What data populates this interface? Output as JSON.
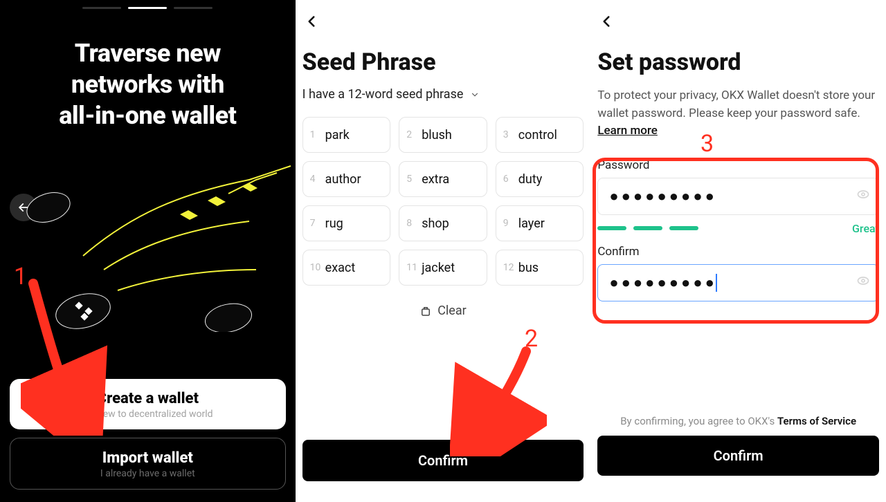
{
  "annotations": {
    "n1": "1",
    "n2": "2",
    "n3": "3"
  },
  "panel1": {
    "headline_l1": "Traverse new",
    "headline_l2": "networks with",
    "headline_l3": "all-in-one wallet",
    "create_title": "Create a wallet",
    "create_sub": "I'm new to decentralized world",
    "import_title": "Import wallet",
    "import_sub": "I already have a wallet"
  },
  "panel2": {
    "title": "Seed Phrase",
    "select_label": "I have a 12-word seed phrase",
    "words": [
      "park",
      "blush",
      "control",
      "author",
      "extra",
      "duty",
      "rug",
      "shop",
      "layer",
      "exact",
      "jacket",
      "bus"
    ],
    "clear": "Clear",
    "confirm": "Confirm"
  },
  "panel3": {
    "title": "Set password",
    "desc_a": "To protect your privacy, OKX Wallet doesn't store your wallet password. Please keep your password safe.  ",
    "learn": "Learn more",
    "pwd_label": "Password",
    "pwd_mask": "●●●●●●●●●",
    "confirm_label": "Confirm",
    "confirm_mask": "●●●●●●●●●",
    "strength": "Great",
    "tos_a": "By confirming, you agree to OKX's ",
    "tos_b": "Terms of Service",
    "confirm_btn": "Confirm"
  }
}
